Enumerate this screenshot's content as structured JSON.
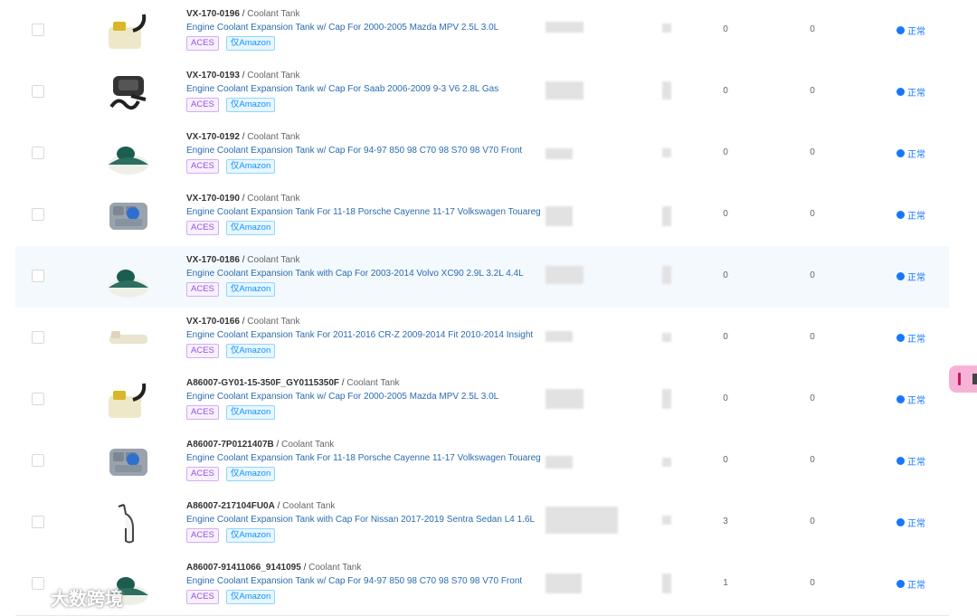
{
  "rows": [
    {
      "sku": "VX-170-0196",
      "category": "Coolant Tank",
      "title": "Engine Coolant Expansion Tank w/ Cap For 2000-2005 Mazda MPV 2.5L 3.0L",
      "tag1": "ACES",
      "tag2": "仅Amazon",
      "v1": "0",
      "v2": "0",
      "status": "正常",
      "img": "cap-tank-icon",
      "highlight": false
    },
    {
      "sku": "VX-170-0193",
      "category": "Coolant Tank",
      "title": "Engine Coolant Expansion Tank w/ Cap For Saab 2006-2009 9-3 V6 2.8L Gas",
      "tag1": "ACES",
      "tag2": "仅Amazon",
      "v1": "0",
      "v2": "0",
      "status": "正常",
      "img": "hose-tank-icon",
      "highlight": false
    },
    {
      "sku": "VX-170-0192",
      "category": "Coolant Tank",
      "title": "Engine Coolant Expansion Tank w/ Cap For 94-97 850 98 C70 98 S70 98 V70 Front",
      "tag1": "ACES",
      "tag2": "仅Amazon",
      "v1": "0",
      "v2": "0",
      "status": "正常",
      "img": "green-cap-tank-icon",
      "highlight": false
    },
    {
      "sku": "VX-170-0190",
      "category": "Coolant Tank",
      "title": "Engine Coolant Expansion Tank For 11-18 Porsche Cayenne 11-17 Volkswagen Touareg",
      "tag1": "ACES",
      "tag2": "仅Amazon",
      "v1": "0",
      "v2": "0",
      "status": "正常",
      "img": "grey-tank-icon",
      "highlight": false
    },
    {
      "sku": "VX-170-0186",
      "category": "Coolant Tank",
      "title": "Engine Coolant Expansion Tank with Cap For 2003-2014 Volvo XC90 2.9L 3.2L 4.4L",
      "tag1": "ACES",
      "tag2": "仅Amazon",
      "v1": "0",
      "v2": "0",
      "status": "正常",
      "img": "green-cap-tank-icon",
      "highlight": true
    },
    {
      "sku": "VX-170-0166",
      "category": "Coolant Tank",
      "title": "Engine Coolant Expansion Tank For 2011-2016 CR-Z 2009-2014 Fit 2010-2014 Insight",
      "tag1": "ACES",
      "tag2": "仅Amazon",
      "v1": "0",
      "v2": "0",
      "status": "正常",
      "img": "long-tank-icon",
      "highlight": false
    },
    {
      "sku": "A86007-GY01-15-350F_GY0115350F",
      "category": "Coolant Tank",
      "title": "Engine Coolant Expansion Tank w/ Cap For 2000-2005 Mazda MPV 2.5L 3.0L",
      "tag1": "ACES",
      "tag2": "仅Amazon",
      "v1": "0",
      "v2": "0",
      "status": "正常",
      "img": "cap-tank-icon",
      "highlight": false
    },
    {
      "sku": "A86007-7P0121407B",
      "category": "Coolant Tank",
      "title": "Engine Coolant Expansion Tank For 11-18 Porsche Cayenne 11-17 Volkswagen Touareg",
      "tag1": "ACES",
      "tag2": "仅Amazon",
      "v1": "0",
      "v2": "0",
      "status": "正常",
      "img": "grey-tank-icon",
      "highlight": false
    },
    {
      "sku": "A86007-217104FU0A",
      "category": "Coolant Tank",
      "title": "Engine Coolant Expansion Tank with Cap For Nissan 2017-2019 Sentra Sedan L4 1.6L",
      "tag1": "ACES",
      "tag2": "仅Amazon",
      "v1": "3",
      "v2": "0",
      "status": "正常",
      "img": "bottle-icon",
      "highlight": false
    },
    {
      "sku": "A86007-91411066_9141095",
      "category": "Coolant Tank",
      "title": "Engine Coolant Expansion Tank w/ Cap For 94-97 850 98 C70 98 S70 98 V70 Front",
      "tag1": "ACES",
      "tag2": "仅Amazon",
      "v1": "1",
      "v2": "0",
      "status": "正常",
      "img": "green-cap-tank-icon",
      "highlight": false
    }
  ],
  "watermark": "大数跨境",
  "colors": {
    "link": "#2b6cb0",
    "status": "#1677ff",
    "aces": "#9254de",
    "amazon": "#1890ff"
  }
}
